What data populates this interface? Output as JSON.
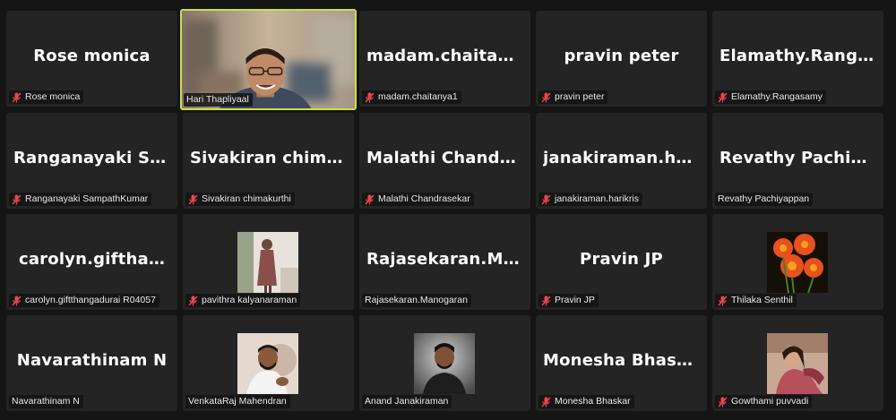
{
  "participants": [
    {
      "display": "Rose monica",
      "label": "Rose monica",
      "muted": true
    },
    {
      "display": "",
      "label": "Hari Thapliyaal",
      "muted": false,
      "video": true,
      "active": true
    },
    {
      "display": "madam.chaitan…",
      "label": "madam.chaitanya1",
      "muted": true
    },
    {
      "display": "pravin peter",
      "label": "pravin peter",
      "muted": true
    },
    {
      "display": "Elamathy.Ranga…",
      "label": "Elamathy.Rangasamy",
      "muted": true
    },
    {
      "display": "Ranganayaki  Sa…",
      "label": "Ranganayaki SampathKumar",
      "muted": true
    },
    {
      "display": "Sivakiran  chima…",
      "label": "Sivakiran chimakurthi",
      "muted": true
    },
    {
      "display": "Malathi  Chandr…",
      "label": "Malathi Chandrasekar",
      "muted": true
    },
    {
      "display": "janakiraman.ha…",
      "label": "janakiraman.harikris",
      "muted": true
    },
    {
      "display": "Revathy  Pachiy…",
      "label": "Revathy Pachiyappan",
      "muted": false
    },
    {
      "display": "carolyn.giftha…",
      "label": "carolyn.giftthangadurai R04057",
      "muted": true
    },
    {
      "display": "",
      "label": "pavithra kalyanaraman",
      "muted": true,
      "photo": "woman-standing"
    },
    {
      "display": "Rajasekaran.Ma…",
      "label": "Rajasekaran.Manogaran",
      "muted": false
    },
    {
      "display": "Pravin JP",
      "label": "Pravin JP",
      "muted": true
    },
    {
      "display": "",
      "label": "Thilaka Senthil",
      "muted": true,
      "photo": "flowers"
    },
    {
      "display": "Navarathinam N",
      "label": "Navarathinam N",
      "muted": false
    },
    {
      "display": "",
      "label": "VenkataRaj Mahendran",
      "muted": false,
      "photo": "man-beard"
    },
    {
      "display": "",
      "label": "Anand Janakiraman",
      "muted": false,
      "photo": "man-dark"
    },
    {
      "display": "Monesha Bhaskar",
      "label": "Monesha Bhaskar",
      "muted": true
    },
    {
      "display": "",
      "label": "Gowthami puvvadi",
      "muted": true,
      "photo": "woman-pink"
    }
  ],
  "colors": {
    "background": "#151515",
    "tile": "#242424",
    "active_border": "#c9e04a",
    "mute_icon": "#e5484d"
  }
}
